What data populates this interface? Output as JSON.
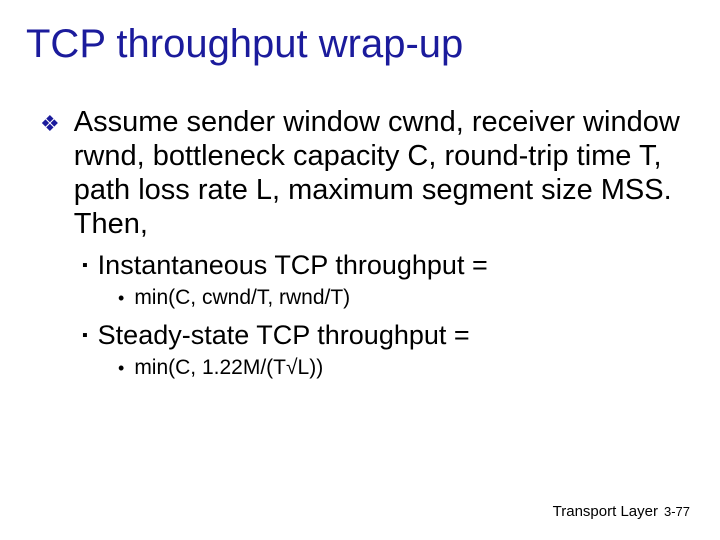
{
  "title": "TCP throughput wrap-up",
  "body": {
    "p1": "Assume sender window cwnd, receiver window rwnd, bottleneck capacity C, round-trip time T, path loss rate L, maximum segment size MSS. Then,",
    "s1": "Instantaneous TCP throughput =",
    "s1_detail": "min(C, cwnd/T, rwnd/T)",
    "s2": "Steady-state TCP throughput =",
    "s2_detail": "min(C, 1.22M/(T√L))"
  },
  "footer": {
    "label": "Transport Layer",
    "page": "3-77"
  },
  "bullets": {
    "lvl1": "❖",
    "lvl2": "▪",
    "lvl3": "•"
  }
}
